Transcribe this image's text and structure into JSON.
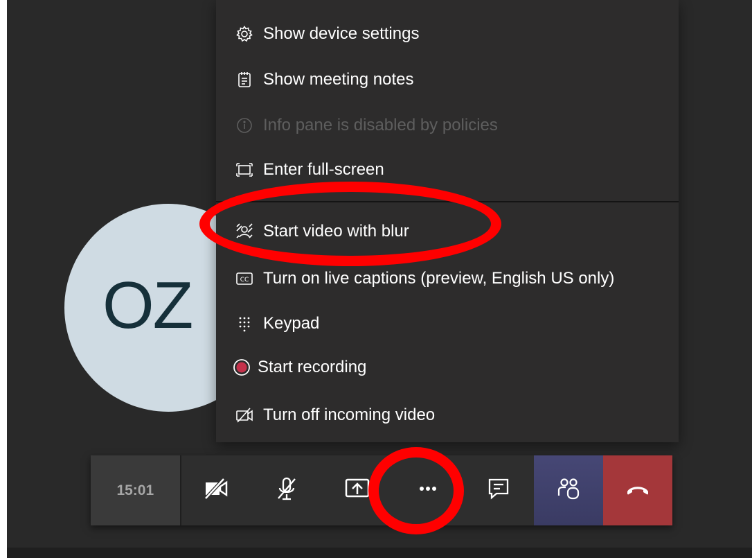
{
  "participant": {
    "initials": "OZ"
  },
  "menu": {
    "items": [
      {
        "icon": "gear-icon",
        "label": "Show device settings",
        "enabled": true
      },
      {
        "icon": "notes-icon",
        "label": "Show meeting notes",
        "enabled": true
      },
      {
        "icon": "info-icon",
        "label": "Info pane is disabled by policies",
        "enabled": false
      },
      {
        "icon": "fullscreen-icon",
        "label": "Enter full-screen",
        "enabled": true
      },
      {
        "icon": "blur-background-icon",
        "label": "Start video with blur",
        "enabled": true
      },
      {
        "icon": "closed-captions-icon",
        "label": "Turn on live captions (preview, English US only)",
        "enabled": true
      },
      {
        "icon": "keypad-icon",
        "label": "Keypad",
        "enabled": true
      },
      {
        "icon": "record-icon",
        "label": "Start recording",
        "enabled": true
      },
      {
        "icon": "video-off-icon",
        "label": "Turn off incoming video",
        "enabled": true
      }
    ]
  },
  "toolbar": {
    "timer": "15:01",
    "buttons": [
      {
        "name": "camera-toggle",
        "icon": "camera-off-icon"
      },
      {
        "name": "mic-toggle",
        "icon": "mic-muted-icon"
      },
      {
        "name": "share-screen",
        "icon": "share-screen-icon"
      },
      {
        "name": "more-actions",
        "icon": "more-dots-icon"
      },
      {
        "name": "chat",
        "icon": "chat-icon"
      },
      {
        "name": "participants",
        "icon": "participants-icon"
      },
      {
        "name": "hang-up",
        "icon": "hang-up-icon"
      }
    ]
  },
  "colors": {
    "stage_background": "#292929",
    "menu_background": "#2d2c2c",
    "participants_button": "#464775",
    "hangup_button": "#a4373a",
    "annotation_red": "#ff0000",
    "record_red": "#c4314b"
  }
}
